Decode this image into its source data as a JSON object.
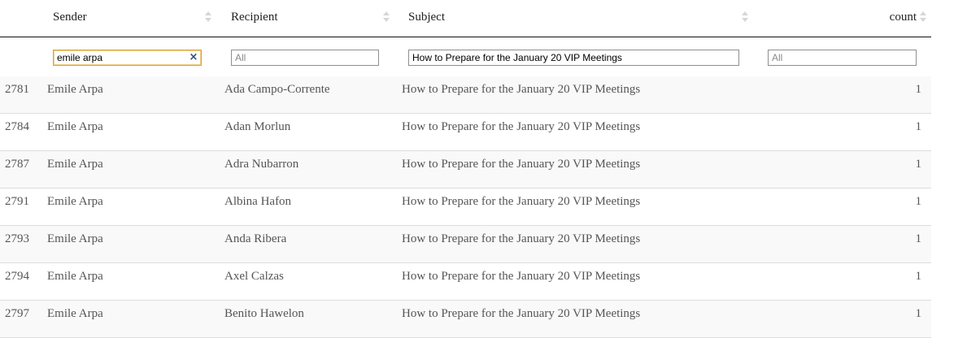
{
  "header": {
    "columns": [
      "Sender",
      "Recipient",
      "Subject",
      "count"
    ]
  },
  "filters": {
    "sender": {
      "value": "emile arpa",
      "placeholder": "All",
      "clear_icon": "×"
    },
    "recipient": {
      "value": "",
      "placeholder": "All"
    },
    "subject": {
      "value": "How to Prepare for the January 20 VIP Meetings",
      "placeholder": "All"
    },
    "count": {
      "value": "",
      "placeholder": "All"
    }
  },
  "rows": [
    {
      "id": "2781",
      "sender": "Emile Arpa",
      "recipient": "Ada Campo-Corrente",
      "subject": "How to Prepare for the January 20 VIP Meetings",
      "count": "1"
    },
    {
      "id": "2784",
      "sender": "Emile Arpa",
      "recipient": "Adan Morlun",
      "subject": "How to Prepare for the January 20 VIP Meetings",
      "count": "1"
    },
    {
      "id": "2787",
      "sender": "Emile Arpa",
      "recipient": "Adra Nubarron",
      "subject": "How to Prepare for the January 20 VIP Meetings",
      "count": "1"
    },
    {
      "id": "2791",
      "sender": "Emile Arpa",
      "recipient": "Albina Hafon",
      "subject": "How to Prepare for the January 20 VIP Meetings",
      "count": "1"
    },
    {
      "id": "2793",
      "sender": "Emile Arpa",
      "recipient": "Anda Ribera",
      "subject": "How to Prepare for the January 20 VIP Meetings",
      "count": "1"
    },
    {
      "id": "2794",
      "sender": "Emile Arpa",
      "recipient": "Axel Calzas",
      "subject": "How to Prepare for the January 20 VIP Meetings",
      "count": "1"
    },
    {
      "id": "2797",
      "sender": "Emile Arpa",
      "recipient": "Benito Hawelon",
      "subject": "How to Prepare for the January 20 VIP Meetings",
      "count": "1"
    }
  ]
}
